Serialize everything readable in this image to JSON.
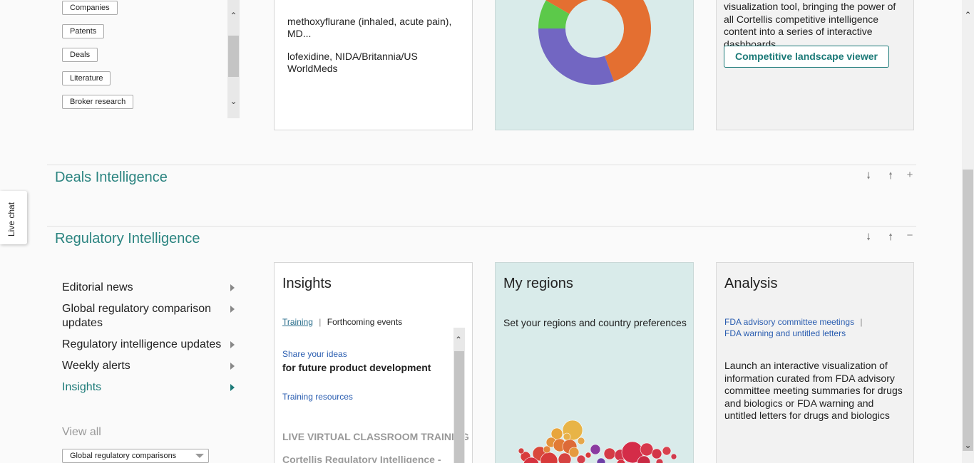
{
  "top_chips": [
    "Companies",
    "Patents",
    "Deals",
    "Literature",
    "Broker research"
  ],
  "drugs_card": {
    "items": [
      "methoxyflurane (inhaled, acute pain), MD...",
      "lofexidine, NIDA/Britannia/US WorldMeds"
    ]
  },
  "cli_card": {
    "description": "visualization tool, bringing the power of all Cortellis competitive intelligence content into a series of interactive dashboards",
    "button_label": "Competitive landscape viewer"
  },
  "donut_colors": {
    "orange": "#e46f31",
    "purple": "#7266c2",
    "green": "#5cc94a",
    "hole": "#d9ebea"
  },
  "sections": {
    "deals": {
      "title": "Deals Intelligence",
      "controls": [
        "move-down",
        "move-up",
        "expand"
      ]
    },
    "regulatory": {
      "title": "Regulatory Intelligence",
      "controls": [
        "move-down",
        "move-up",
        "collapse"
      ]
    }
  },
  "reg_nav": {
    "items": [
      {
        "label": "Editorial news",
        "active": false
      },
      {
        "label": "Global regulatory comparison updates",
        "active": false
      },
      {
        "label": "Regulatory intelligence updates",
        "active": false
      },
      {
        "label": "Weekly alerts",
        "active": false
      },
      {
        "label": "Insights",
        "active": true
      }
    ],
    "view_all": "View all",
    "select_value": "Global regulatory comparisons"
  },
  "insights": {
    "title": "Insights",
    "tab_training": "Training",
    "tab_separator": "|",
    "tab_events": "Forthcoming events",
    "share_link": "Share your ideas",
    "share_text": "for future product development",
    "training_link": "Training resources",
    "live_heading": "LIVE VIRTUAL CLASSROOM TRAINING",
    "course_partial": "Cortellis Regulatory Intelligence -"
  },
  "regions": {
    "title": "My regions",
    "text": "Set your regions and country preferences"
  },
  "analysis": {
    "title": "Analysis",
    "link1": "FDA advisory committee meetings",
    "separator": "|",
    "link2": "FDA warning and untitled letters",
    "description": "Launch an interactive visualization of information curated from FDA advisory committee meeting summaries for drugs and biologics or FDA warning and untitled letters for drugs and biologics"
  },
  "live_chat": "Live chat",
  "colors": {
    "teal_accent": "#2b8480",
    "link_blue": "#2a5db0"
  }
}
